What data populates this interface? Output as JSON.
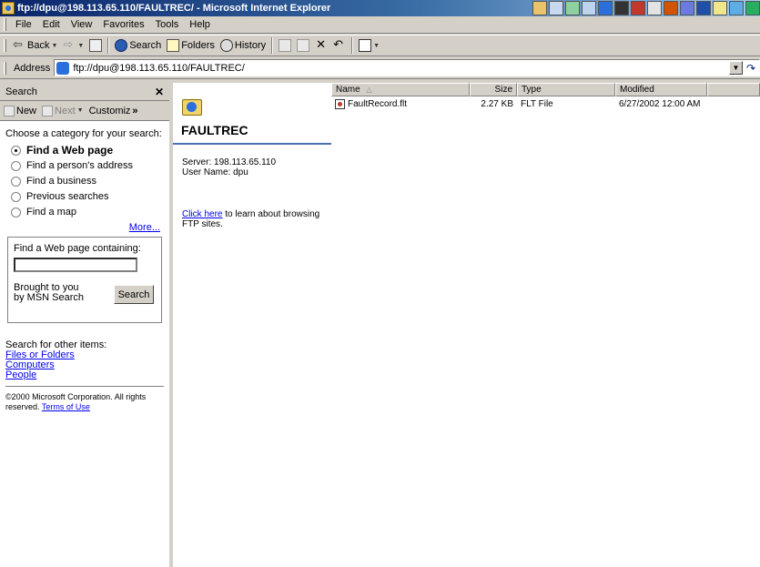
{
  "window": {
    "title": "ftp://dpu@198.113.65.110/FAULTREC/ - Microsoft Internet Explorer"
  },
  "menu": [
    "File",
    "Edit",
    "View",
    "Favorites",
    "Tools",
    "Help"
  ],
  "toolbar": {
    "back": "Back",
    "search": "Search",
    "folders": "Folders",
    "history": "History"
  },
  "address": {
    "label": "Address",
    "url": "ftp://dpu@198.113.65.110/FAULTREC/"
  },
  "search_pane": {
    "title": "Search",
    "new_label": "New",
    "next_label": "Next",
    "customize_label": "Customiz",
    "prompt": "Choose a category for your search:",
    "options": [
      {
        "label": "Find a Web page",
        "selected": true
      },
      {
        "label": "Find a person's address",
        "selected": false
      },
      {
        "label": "Find a business",
        "selected": false
      },
      {
        "label": "Previous searches",
        "selected": false
      },
      {
        "label": "Find a map",
        "selected": false
      }
    ],
    "more_link": "More...",
    "find_label": "Find a Web page containing:",
    "find_value": "",
    "brought_by": "Brought to you by MSN Search",
    "search_button": "Search",
    "other_title": "Search for other items:",
    "other_links": [
      "Files or Folders",
      "Computers",
      "People"
    ],
    "copyright": "©2000 Microsoft Corporation. All rights reserved.",
    "terms_link": "Terms of Use"
  },
  "folder_panel": {
    "title": "FAULTREC",
    "server": "Server: 198.113.65.110",
    "user": "User Name: dpu",
    "help_link": "Click here",
    "help_text": " to learn about browsing FTP sites."
  },
  "file_list": {
    "columns": {
      "name": "Name",
      "size": "Size",
      "type": "Type",
      "modified": "Modified"
    },
    "rows": [
      {
        "name": "FaultRecord.flt",
        "size": "2.27 KB",
        "type": "FLT File",
        "modified": "6/27/2002 12:00 AM"
      }
    ]
  },
  "colors": {
    "title_bar": "#0a246a",
    "chrome": "#d4d0c8",
    "link": "#0000ee",
    "folder_rule": "#4a6fb5"
  }
}
